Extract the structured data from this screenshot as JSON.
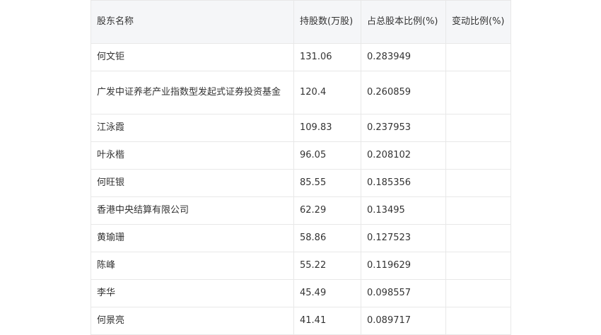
{
  "table": {
    "headers": [
      "股东名称",
      "持股数(万股)",
      "占总股本比例(%)",
      "变动比例(%)"
    ],
    "rows": [
      [
        "何文钜",
        "131.06",
        "0.283949",
        ""
      ],
      [
        "广发中证养老产业指数型发起式证券投资基金",
        "120.4",
        "0.260859",
        ""
      ],
      [
        "江泳霞",
        "109.83",
        "0.237953",
        ""
      ],
      [
        "叶永楷",
        "96.05",
        "0.208102",
        ""
      ],
      [
        "何旺银",
        "85.55",
        "0.185356",
        ""
      ],
      [
        "香港中央结算有限公司",
        "62.29",
        "0.13495",
        ""
      ],
      [
        "黄瑜珊",
        "58.86",
        "0.127523",
        ""
      ],
      [
        "陈峰",
        "55.22",
        "0.119629",
        ""
      ],
      [
        "李华",
        "45.49",
        "0.098557",
        ""
      ],
      [
        "何景亮",
        "41.41",
        "0.089717",
        ""
      ]
    ]
  }
}
